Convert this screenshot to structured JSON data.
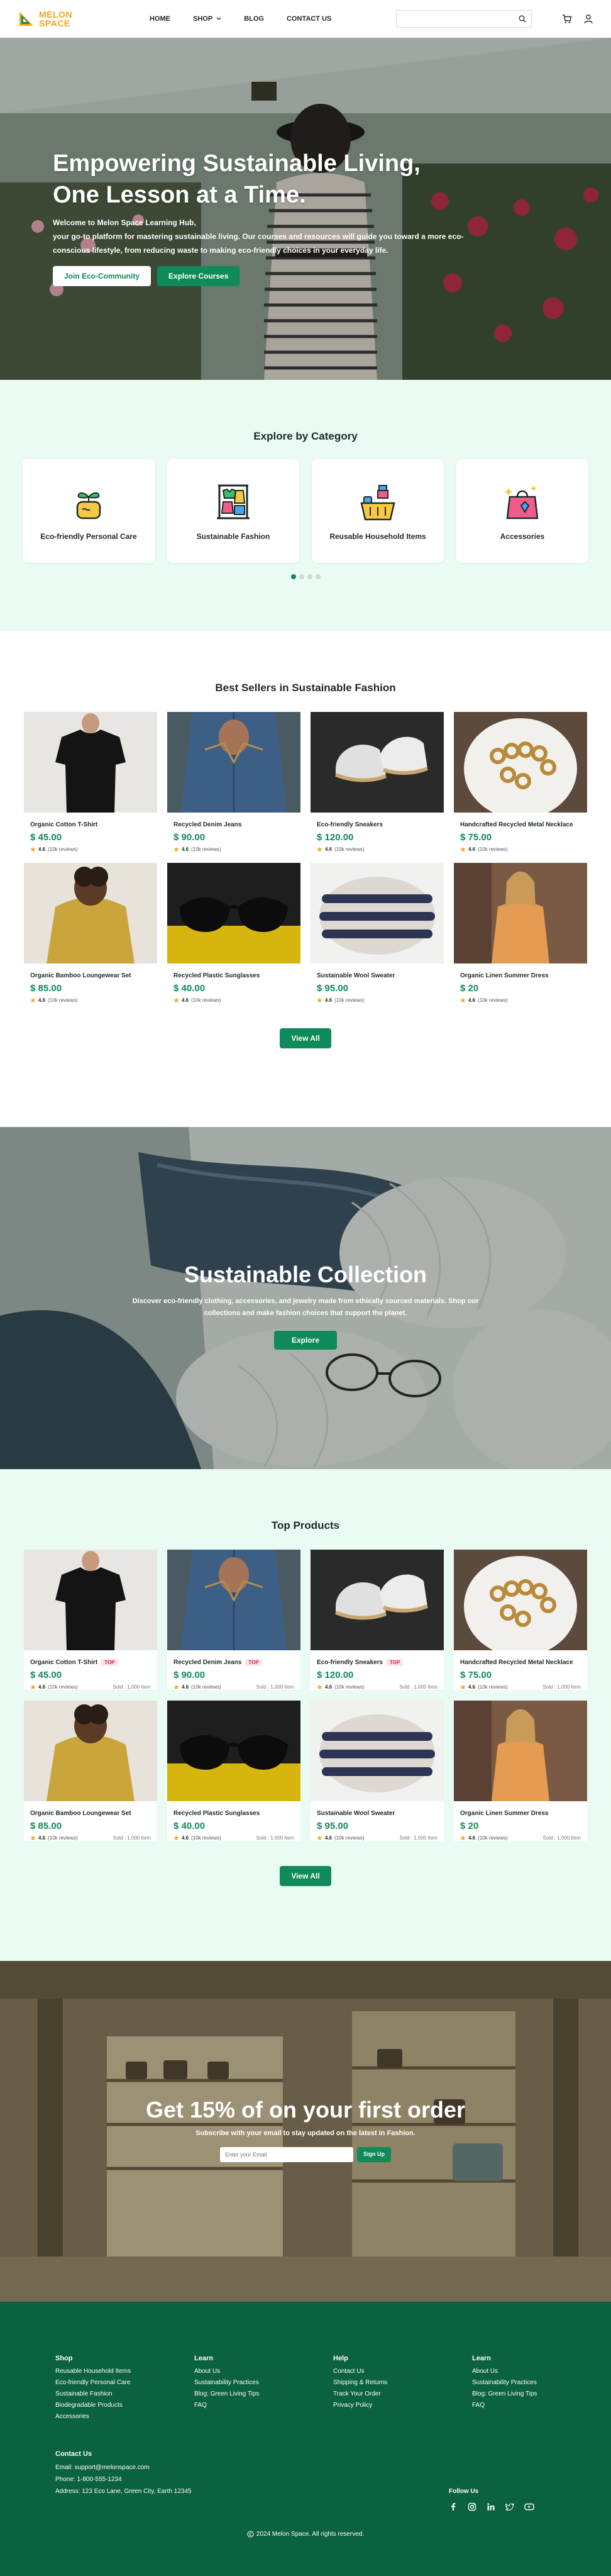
{
  "brand": {
    "logo_line1": "MELON",
    "logo_line2": "SPACE",
    "accent": "#0f8a5a",
    "footer_bg": "#0b6240"
  },
  "nav": {
    "items": [
      "HOME",
      "SHOP",
      "BLOG",
      "CONTACT US"
    ],
    "search_placeholder": ""
  },
  "hero": {
    "title_line1": "Empowering Sustainable Living,",
    "title_line2": "One Lesson at a Time.",
    "intro_line1": "Welcome to Melon Space Learning Hub,",
    "intro_line2": "your go-to platform for mastering sustainable living. Our courses and resources will guide you toward a more eco-",
    "intro_line3": "conscious lifestyle, from reducing waste to making eco-friendly choices in your everyday life.",
    "primary_cta": "Join Eco-Community",
    "secondary_cta": "Explore Courses"
  },
  "categories": {
    "title": "Explore by Category",
    "items": [
      {
        "label": "Eco-friendly Personal Care",
        "icon": "plant-bottle-icon"
      },
      {
        "label": "Sustainable Fashion",
        "icon": "clothes-rack-icon"
      },
      {
        "label": "Reusable Household Items",
        "icon": "cleaning-supplies-icon"
      },
      {
        "label": "Accessories",
        "icon": "shopping-bag-icon"
      }
    ]
  },
  "best_sellers": {
    "title": "Best Sellers in Sustainable Fashion",
    "view_all": "View All",
    "products": [
      {
        "name": "Organic Cotton T-Shirt",
        "price": "$ 45.00",
        "rating": "4.6",
        "reviews": "(10k reviews)"
      },
      {
        "name": "Recycled Denim Jeans",
        "price": "$ 90.00",
        "rating": "4.6",
        "reviews": "(10k reviews)"
      },
      {
        "name": "Eco-friendly Sneakers",
        "price": "$ 120.00",
        "rating": "4.6",
        "reviews": "(10k reviews)"
      },
      {
        "name": "Handcrafted Recycled Metal Necklace",
        "price": "$ 75.00",
        "rating": "4.6",
        "reviews": "(10k reviews)"
      },
      {
        "name": "Organic Bamboo Loungewear Set",
        "price": "$ 85.00",
        "rating": "4.6",
        "reviews": "(10k reviews)"
      },
      {
        "name": "Recycled Plastic Sunglasses",
        "price": "$ 40.00",
        "rating": "4.6",
        "reviews": "(10k reviews)"
      },
      {
        "name": "Sustainable Wool Sweater",
        "price": "$ 95.00",
        "rating": "4.6",
        "reviews": "(10k reviews)"
      },
      {
        "name": "Organic Linen Summer Dress",
        "price": "$ 20",
        "rating": "4.6",
        "reviews": "(10k reviews)"
      }
    ]
  },
  "collection": {
    "title": "Sustainable Collection",
    "desc_line1": "Discover eco-friendly clothing, accessories, and jewelry made from ethically sourced materials. Shop our",
    "desc_line2": "collections and make fashion choices that support the planet.",
    "cta": "Explore"
  },
  "top_products": {
    "title": "Top Products",
    "view_all": "View All",
    "tag": "TOP",
    "sold": "Sold : 1,000 Item",
    "products": [
      {
        "name": "Organic Cotton T-Shirt",
        "price": "$ 45.00",
        "rating": "4.6",
        "reviews": "(10k reviews)",
        "top": true
      },
      {
        "name": "Recycled Denim Jeans",
        "price": "$ 90.00",
        "rating": "4.6",
        "reviews": "(10k reviews)",
        "top": true
      },
      {
        "name": "Eco-friendly Sneakers",
        "price": "$ 120.00",
        "rating": "4.6",
        "reviews": "(10k reviews)",
        "top": true
      },
      {
        "name": "Handcrafted Recycled Metal Necklace",
        "price": "$ 75.00",
        "rating": "4.6",
        "reviews": "(10k reviews)",
        "top": false
      },
      {
        "name": "Organic Bamboo Loungewear Set",
        "price": "$ 85.00",
        "rating": "4.6",
        "reviews": "(10k reviews)",
        "top": false
      },
      {
        "name": "Recycled Plastic Sunglasses",
        "price": "$ 40.00",
        "rating": "4.6",
        "reviews": "(10k reviews)",
        "top": false
      },
      {
        "name": "Sustainable Wool Sweater",
        "price": "$ 95.00",
        "rating": "4.6",
        "reviews": "(10k reviews)",
        "top": false
      },
      {
        "name": "Organic Linen Summer Dress",
        "price": "$ 20",
        "rating": "4.6",
        "reviews": "(10k reviews)",
        "top": false
      }
    ]
  },
  "subscribe": {
    "title": "Get 15% of on your first order",
    "subtitle": "Subscribe with your email to stay updated on the latest in Fashion.",
    "placeholder": "Enter your Email",
    "button": "Sign Up"
  },
  "footer": {
    "columns": [
      {
        "title": "Shop",
        "links": [
          "Reusable Household Items",
          "Eco-friendly Personal Care",
          "Sustainable Fashion",
          "Biodegradable Products",
          "Accessories"
        ]
      },
      {
        "title": "Learn",
        "links": [
          "About Us",
          "Sustainability Practices",
          "Blog: Green Living Tips",
          "FAQ"
        ]
      },
      {
        "title": "Help",
        "links": [
          "Contact Us",
          "Shipping & Returns",
          "Track Your Order",
          "Privacy Policy"
        ]
      },
      {
        "title": "Learn",
        "links": [
          "About Us",
          "Sustainability Practices",
          "Blog: Green Living Tips",
          "FAQ"
        ]
      }
    ],
    "contact_title": "Contact Us",
    "email": "Email: support@melonspace.com",
    "phone": "Phone: 1-800-555-1234",
    "address": "Address: 123 Eco Lane, Green City, Earth 12345",
    "follow": "Follow Us",
    "social": [
      "facebook-icon",
      "instagram-icon",
      "linkedin-icon",
      "twitter-icon",
      "youtube-icon"
    ],
    "copyright": "2024 Melon Space. All rights reserved."
  }
}
